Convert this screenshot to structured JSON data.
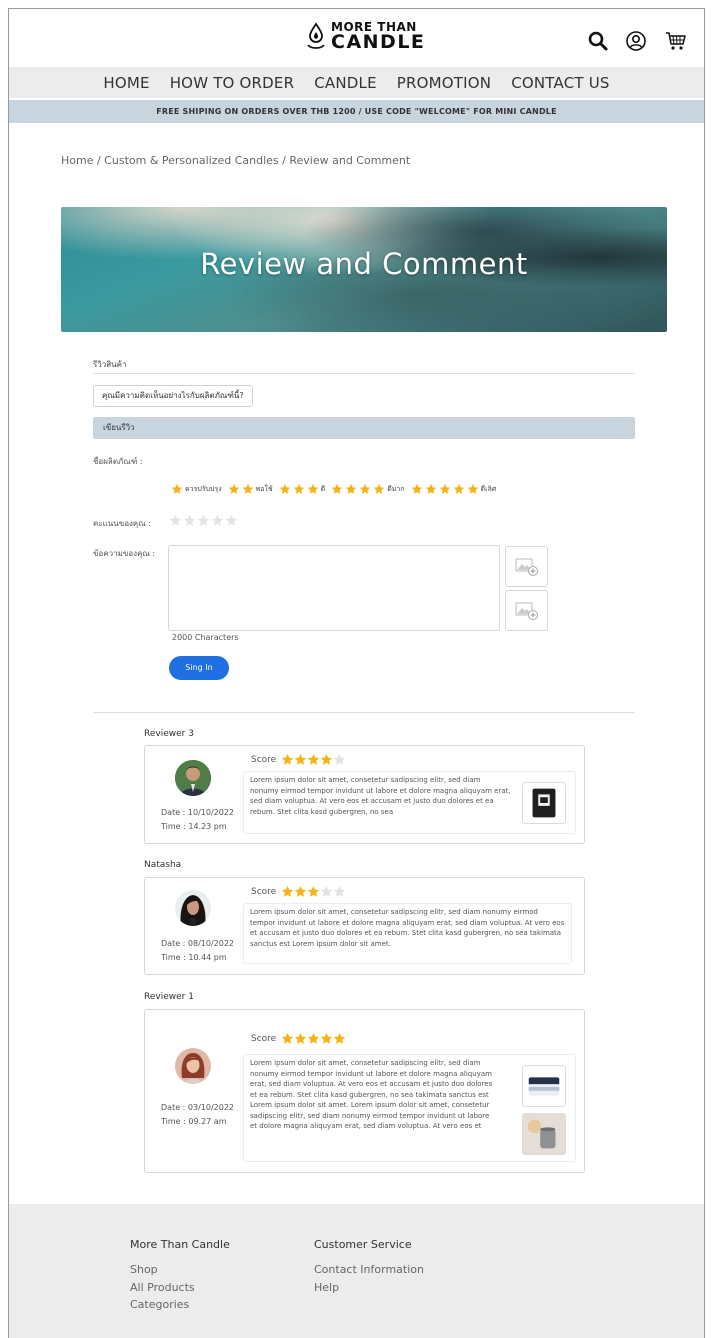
{
  "brand": {
    "line1": "MORE THAN",
    "line2": "CANDLE"
  },
  "header_icons": [
    "search-icon",
    "user-icon",
    "cart-icon"
  ],
  "nav": [
    "HOME",
    "HOW TO ORDER",
    "CANDLE",
    "PROMOTION",
    "CONTACT US"
  ],
  "promo": "FREE SHIPING ON ORDERS OVER THB 1200 / USE CODE \"WELCOME\" FOR MINI CANDLE",
  "breadcrumb": "Home / Custom & Personalized Candles / Review and Comment",
  "hero_title": "Review and Comment",
  "form": {
    "tab_label": "รีวิวสินค้า",
    "question": "คุณมีความคิดเห็นอย่างไรกับผลิตภัณฑ์นี้?",
    "write_review": "เขียนรีวิว",
    "product_name_label": "ชื่อผลิตภัณฑ์ :",
    "legend": [
      {
        "stars": 1,
        "label": "ควรปรับปรุง"
      },
      {
        "stars": 2,
        "label": "พอใช้"
      },
      {
        "stars": 3,
        "label": "ดี"
      },
      {
        "stars": 4,
        "label": "ดีมาก"
      },
      {
        "stars": 5,
        "label": "ดีเลิศ"
      }
    ],
    "score_label": "คะแนนของคุณ :",
    "rating": 0,
    "message_label": "ข้อความของคุณ :",
    "char_limit": "2000 Characters",
    "submit": "Sing In"
  },
  "reviews": [
    {
      "name": "Reviewer 3",
      "date": "Date : 10/10/2022",
      "time": "Time : 14.23 pm",
      "score_label": "Score",
      "score": 4,
      "text": "Lorem ipsum dolor sit amet, consetetur sadipscing elitr, sed diam nonumy eirmod tempor invidunt ut labore et dolore magna aliquyam erat, sed diam voluptua. At vero eos et accusam et justo duo dolores et ea rebum. Stet clita kasd gubergren, no sea"
    },
    {
      "name": "Natasha",
      "date": "Date : 08/10/2022",
      "time": "Time : 10.44 pm",
      "score_label": "Score",
      "score": 3,
      "text": "Lorem ipsum dolor sit amet, consetetur sadipscing elitr, sed diam nonumy eirmod tempor invidunt ut labore et dolore magna aliquyam erat, sed diam voluptua. At vero eos et accusam et justo duo dolores et ea rebum. Stet clita kasd gubergren, no sea takimata sanctus est Lorem ipsum dolor sit amet."
    },
    {
      "name": "Reviewer 1",
      "date": "Date : 03/10/2022",
      "time": "Time : 09.27 am",
      "score_label": "Score",
      "score": 5,
      "text": "Lorem ipsum dolor sit amet, consetetur sadipscing elitr, sed diam nonumy eirmod tempor invidunt ut labore et dolore magna aliquyam erat, sed diam voluptua. At vero eos et accusam et justo duo dolores et ea rebum. Stet clita kasd gubergren, no sea takimata sanctus est Lorem ipsum dolor sit amet. Lorem ipsum dolor sit amet, consetetur sadipscing elitr, sed diam nonumy eirmod tempor invidunt ut labore et dolore magna aliquyam erat, sed diam voluptua. At vero eos et"
    }
  ],
  "footer": {
    "col1": {
      "title": "More Than Candle",
      "links": [
        "Shop",
        "All Products",
        "Categories"
      ]
    },
    "col2": {
      "title": "Customer Service",
      "links": [
        "Contact Information",
        "Help"
      ]
    }
  },
  "colors": {
    "accent": "#1f6fe0",
    "star": "#f5b316",
    "bar": "#c8d4de",
    "nav_bg": "#ececec"
  }
}
